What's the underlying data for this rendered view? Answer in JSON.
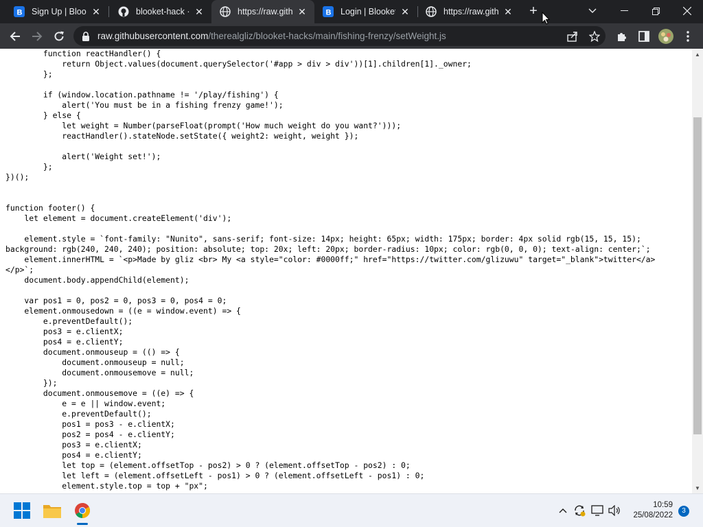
{
  "browser": {
    "tabs": [
      {
        "title": "Sign Up | Blooket",
        "icon": "blooket-icon",
        "active": false
      },
      {
        "title": "blooket-hack · GitHub",
        "icon": "github-icon",
        "active": false
      },
      {
        "title": "https://raw.githubusercontent.com",
        "icon": "globe-icon",
        "active": true
      },
      {
        "title": "Login | Blooket",
        "icon": "blooket-icon",
        "active": false
      },
      {
        "title": "https://raw.githubusercontent.com",
        "icon": "globe-icon",
        "active": false
      }
    ],
    "address": {
      "host": "raw.githubusercontent.com",
      "path": "/therealgliz/blooket-hacks/main/fishing-frenzy/setWeight.js"
    },
    "colors": {
      "tabstrip": "#202124",
      "toolbar": "#35363a",
      "omnibox": "#202124",
      "blooket": "#1a73e8"
    }
  },
  "code_lines": [
    "        function reactHandler() {",
    "            return Object.values(document.querySelector('#app > div > div'))[1].children[1]._owner;",
    "        };",
    "",
    "        if (window.location.pathname != '/play/fishing') {",
    "            alert('You must be in a fishing frenzy game!');",
    "        } else {",
    "            let weight = Number(parseFloat(prompt('How much weight do you want?')));",
    "            reactHandler().stateNode.setState({ weight2: weight, weight });",
    "",
    "            alert('Weight set!');",
    "        };",
    "})();",
    "",
    "",
    "function footer() {",
    "    let element = document.createElement('div');",
    "",
    "    element.style = `font-family: \"Nunito\", sans-serif; font-size: 14px; height: 65px; width: 175px; border: 4px solid rgb(15, 15, 15);",
    "background: rgb(240, 240, 240); position: absolute; top: 20x; left: 20px; border-radius: 10px; color: rgb(0, 0, 0); text-align: center;`;",
    "    element.innerHTML = `<p>Made by gliz <br> My <a style=\"color: #0000ff;\" href=\"https://twitter.com/glizuwu\" target=\"_blank\">twitter</a>",
    "</p>`;",
    "    document.body.appendChild(element);",
    "",
    "    var pos1 = 0, pos2 = 0, pos3 = 0, pos4 = 0;",
    "    element.onmousedown = ((e = window.event) => {",
    "        e.preventDefault();",
    "        pos3 = e.clientX;",
    "        pos4 = e.clientY;",
    "        document.onmouseup = (() => {",
    "            document.onmouseup = null;",
    "            document.onmousemove = null;",
    "        });",
    "        document.onmousemove = ((e) => {",
    "            e = e || window.event;",
    "            e.preventDefault();",
    "            pos1 = pos3 - e.clientX;",
    "            pos2 = pos4 - e.clientY;",
    "            pos3 = e.clientX;",
    "            pos4 = e.clientY;",
    "            let top = (element.offsetTop - pos2) > 0 ? (element.offsetTop - pos2) : 0;",
    "            let left = (element.offsetLeft - pos1) > 0 ? (element.offsetLeft - pos1) : 0;",
    "            element.style.top = top + \"px\";"
  ],
  "taskbar": {
    "apps": [
      "windows-start-icon",
      "file-explorer-icon",
      "chrome-icon"
    ],
    "time": "10:59",
    "date": "25/08/2022",
    "notifications": "3"
  }
}
